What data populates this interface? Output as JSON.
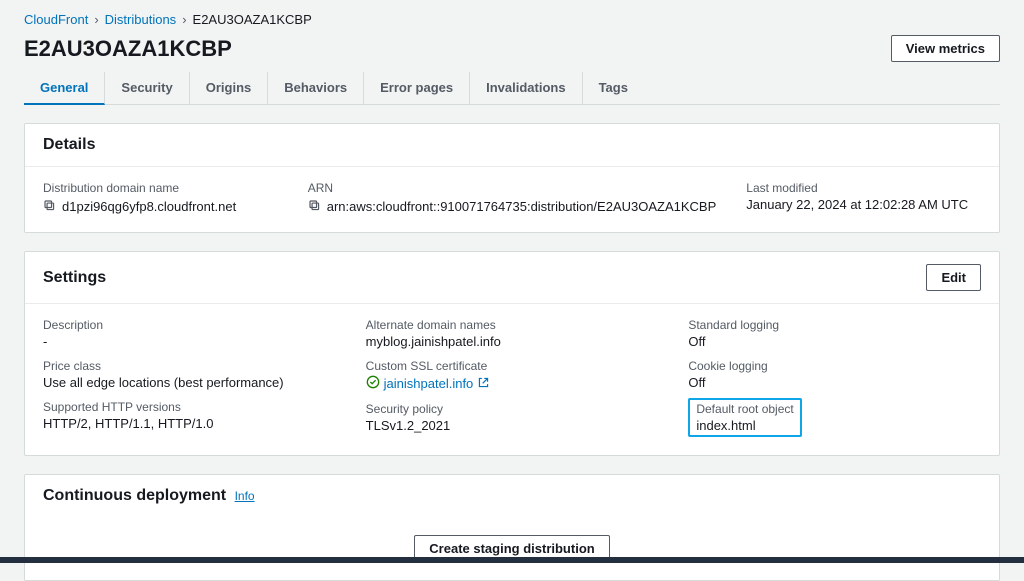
{
  "breadcrumb": {
    "root": "CloudFront",
    "section": "Distributions",
    "current": "E2AU3OAZA1KCBP"
  },
  "header": {
    "title": "E2AU3OAZA1KCBP",
    "view_metrics": "View metrics"
  },
  "tabs": {
    "general": "General",
    "security": "Security",
    "origins": "Origins",
    "behaviors": "Behaviors",
    "error_pages": "Error pages",
    "invalidations": "Invalidations",
    "tags": "Tags"
  },
  "details": {
    "title": "Details",
    "domain_label": "Distribution domain name",
    "domain_value": "d1pzi96qg6yfp8.cloudfront.net",
    "arn_label": "ARN",
    "arn_value": "arn:aws:cloudfront::910071764735:distribution/E2AU3OAZA1KCBP",
    "last_modified_label": "Last modified",
    "last_modified_value": "January 22, 2024 at 12:02:28 AM UTC"
  },
  "settings": {
    "title": "Settings",
    "edit": "Edit",
    "description_label": "Description",
    "description_value": "-",
    "price_class_label": "Price class",
    "price_class_value": "Use all edge locations (best performance)",
    "http_label": "Supported HTTP versions",
    "http_value": "HTTP/2, HTTP/1.1, HTTP/1.0",
    "alt_domain_label": "Alternate domain names",
    "alt_domain_value": "myblog.jainishpatel.info",
    "ssl_label": "Custom SSL certificate",
    "ssl_value": "jainishpatel.info",
    "sec_policy_label": "Security policy",
    "sec_policy_value": "TLSv1.2_2021",
    "std_log_label": "Standard logging",
    "std_log_value": "Off",
    "cookie_log_label": "Cookie logging",
    "cookie_log_value": "Off",
    "root_obj_label": "Default root object",
    "root_obj_value": "index.html"
  },
  "continuous": {
    "title": "Continuous deployment",
    "info": "Info",
    "create_btn": "Create staging distribution"
  }
}
